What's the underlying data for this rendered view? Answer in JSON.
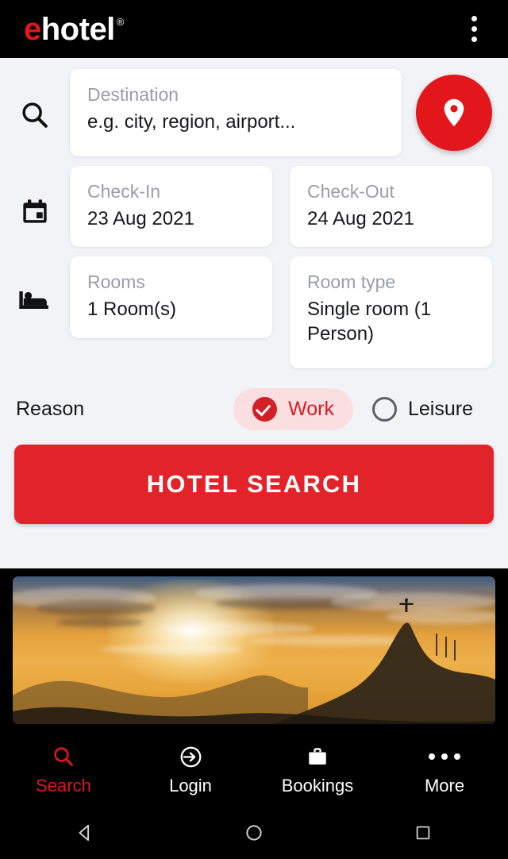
{
  "app": {
    "brand_e": "e",
    "brand_rest": "hotel",
    "brand_reg": "®",
    "overflow_menu": "⋮"
  },
  "search_form": {
    "destination": {
      "icon": "search-icon",
      "label": "Destination",
      "value": "e.g. city, region, airport...",
      "location_button_icon": "map-pin-icon"
    },
    "dates": {
      "icon": "calendar-icon",
      "checkin": {
        "label": "Check-In",
        "value": "23 Aug 2021"
      },
      "checkout": {
        "label": "Check-Out",
        "value": "24 Aug 2021"
      }
    },
    "rooms": {
      "icon": "bed-icon",
      "count": {
        "label": "Rooms",
        "value": "1 Room(s)"
      },
      "type": {
        "label": "Room type",
        "value": "Single room (1 Person)"
      }
    },
    "reason": {
      "label": "Reason",
      "options": [
        {
          "label": "Work",
          "selected": true
        },
        {
          "label": "Leisure",
          "selected": false
        }
      ]
    },
    "submit_label": "HOTEL SEARCH"
  },
  "hero": {
    "alt": "Rio de Janeiro sunset with Christ the Redeemer on Corcovado mountain"
  },
  "bottom_nav": [
    {
      "label": "Search",
      "icon": "search-icon",
      "active": true
    },
    {
      "label": "Login",
      "icon": "login-icon",
      "active": false
    },
    {
      "label": "Bookings",
      "icon": "briefcase-icon",
      "active": false
    },
    {
      "label": "More",
      "icon": "more-dots-icon",
      "active": false
    }
  ],
  "system_nav": [
    {
      "name": "back",
      "icon": "triangle-back-icon"
    },
    {
      "name": "home",
      "icon": "circle-home-icon"
    },
    {
      "name": "recents",
      "icon": "square-recents-icon"
    }
  ],
  "colors": {
    "brand_red": "#E3161C",
    "cta_red": "#E3232A",
    "selected_pill_bg": "#FADEE0",
    "page_bg": "#F1F3F7",
    "card_bg": "#FFFFFF",
    "label_gray": "#9A9EA8"
  }
}
